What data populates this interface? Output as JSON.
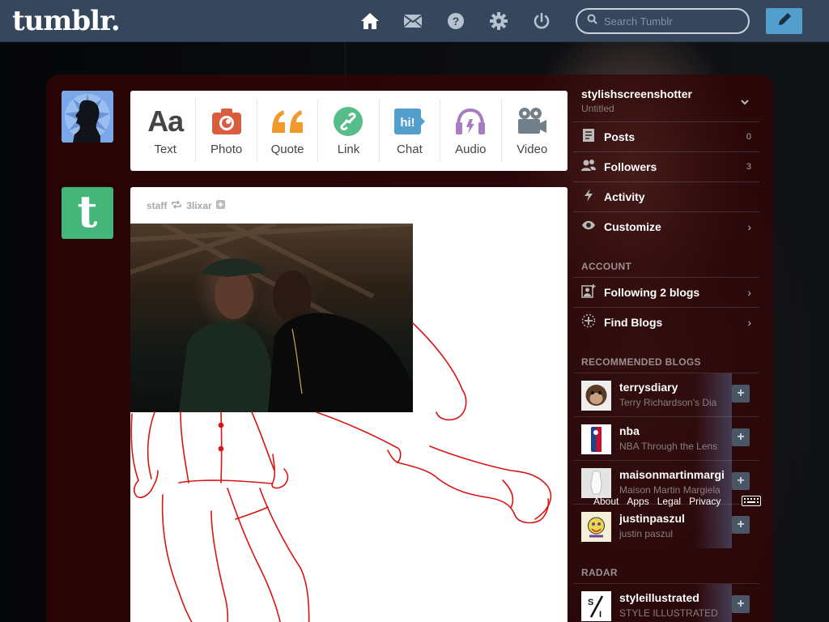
{
  "header": {
    "logo": "tumblr.",
    "search_placeholder": "Search Tumblr",
    "nav_icons": [
      "home-icon",
      "mail-icon",
      "help-icon",
      "gear-icon",
      "power-icon"
    ],
    "compose_icon": "pencil-icon",
    "colors": {
      "bar": "#36465d",
      "compose": "#529ecc"
    }
  },
  "post_types": [
    {
      "label": "Text",
      "icon": "text-icon",
      "color": "#444444"
    },
    {
      "label": "Photo",
      "icon": "camera-icon",
      "color": "#d95e40"
    },
    {
      "label": "Quote",
      "icon": "quote-icon",
      "color": "#f2992e"
    },
    {
      "label": "Link",
      "icon": "link-icon",
      "color": "#56bc8a"
    },
    {
      "label": "Chat",
      "icon": "chat-icon",
      "color": "#529ecc"
    },
    {
      "label": "Audio",
      "icon": "headphones-icon",
      "color": "#a77dc2"
    },
    {
      "label": "Video",
      "icon": "video-camera-icon",
      "color": "#748089"
    }
  ],
  "post": {
    "author": "staff",
    "reblogged_from": "3lixar"
  },
  "sidebar": {
    "blog_name": "stylishscreenshotter",
    "blog_subtitle": "Untitled",
    "items": [
      {
        "label": "Posts",
        "count": "0"
      },
      {
        "label": "Followers",
        "count": "3"
      },
      {
        "label": "Activity"
      },
      {
        "label": "Customize"
      }
    ],
    "account_title": "ACCOUNT",
    "account_items": [
      {
        "label": "Following 2 blogs"
      },
      {
        "label": "Find Blogs"
      }
    ],
    "recommended_title": "RECOMMENDED BLOGS",
    "recommended": [
      {
        "name": "terrysdiary",
        "subtitle": "Terry Richardson's Dia",
        "thumb_color": "#6b4a33"
      },
      {
        "name": "nba",
        "subtitle": "NBA Through the Lens",
        "thumb_color": "#ffffff"
      },
      {
        "name": "maisonmartinmargi",
        "subtitle": "Maison Martin Margiela",
        "thumb_color": "#d8d8d8"
      },
      {
        "name": "justinpaszul",
        "subtitle": "justin paszul",
        "thumb_color": "#f4f0d8"
      }
    ],
    "radar_title": "RADAR",
    "radar": {
      "name": "styleillustrated",
      "subtitle": "STYLE ILLUSTRATED"
    },
    "footer_links": [
      "About",
      "Apps",
      "Legal",
      "Privacy"
    ]
  }
}
